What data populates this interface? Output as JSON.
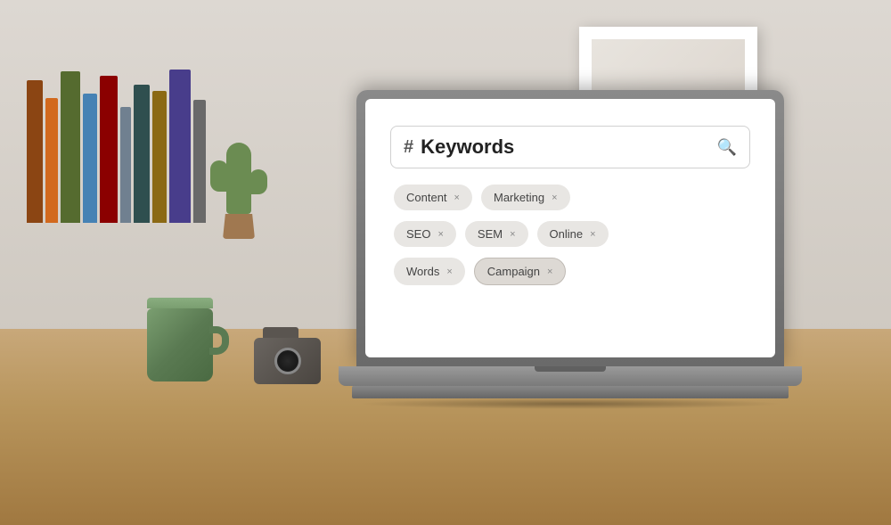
{
  "scene": {
    "title": "Keywords search UI on laptop"
  },
  "laptop": {
    "screen": {
      "search_bar": {
        "hash_symbol": "#",
        "placeholder": "Keywords",
        "search_icon": "🔍"
      },
      "tags": [
        [
          {
            "label": "Content",
            "x": "×"
          },
          {
            "label": "Marketing",
            "x": "×"
          }
        ],
        [
          {
            "label": "SEO",
            "x": "×"
          },
          {
            "label": "SEM",
            "x": "×"
          },
          {
            "label": "Online",
            "x": "×"
          }
        ],
        [
          {
            "label": "Words",
            "x": "×"
          },
          {
            "label": "Campaign",
            "x": "×",
            "highlighted": true
          }
        ]
      ]
    }
  },
  "books": [
    {
      "width": 18,
      "height": 160,
      "color": "#8B4513"
    },
    {
      "width": 14,
      "height": 140,
      "color": "#D2691E"
    },
    {
      "width": 22,
      "height": 170,
      "color": "#556B2F"
    },
    {
      "width": 16,
      "height": 145,
      "color": "#4682B4"
    },
    {
      "width": 20,
      "height": 165,
      "color": "#8B0000"
    },
    {
      "width": 12,
      "height": 130,
      "color": "#708090"
    },
    {
      "width": 18,
      "height": 155,
      "color": "#2F4F4F"
    },
    {
      "width": 16,
      "height": 148,
      "color": "#8B6914"
    },
    {
      "width": 24,
      "height": 172,
      "color": "#483D8B"
    },
    {
      "width": 14,
      "height": 138,
      "color": "#696969"
    }
  ]
}
